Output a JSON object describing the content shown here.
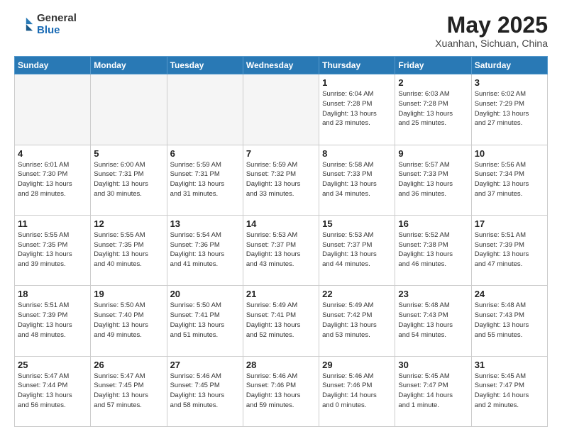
{
  "header": {
    "logo_general": "General",
    "logo_blue": "Blue",
    "month_title": "May 2025",
    "location": "Xuanhan, Sichuan, China"
  },
  "weekdays": [
    "Sunday",
    "Monday",
    "Tuesday",
    "Wednesday",
    "Thursday",
    "Friday",
    "Saturday"
  ],
  "weeks": [
    [
      {
        "day": "",
        "info": ""
      },
      {
        "day": "",
        "info": ""
      },
      {
        "day": "",
        "info": ""
      },
      {
        "day": "",
        "info": ""
      },
      {
        "day": "1",
        "info": "Sunrise: 6:04 AM\nSunset: 7:28 PM\nDaylight: 13 hours\nand 23 minutes."
      },
      {
        "day": "2",
        "info": "Sunrise: 6:03 AM\nSunset: 7:28 PM\nDaylight: 13 hours\nand 25 minutes."
      },
      {
        "day": "3",
        "info": "Sunrise: 6:02 AM\nSunset: 7:29 PM\nDaylight: 13 hours\nand 27 minutes."
      }
    ],
    [
      {
        "day": "4",
        "info": "Sunrise: 6:01 AM\nSunset: 7:30 PM\nDaylight: 13 hours\nand 28 minutes."
      },
      {
        "day": "5",
        "info": "Sunrise: 6:00 AM\nSunset: 7:31 PM\nDaylight: 13 hours\nand 30 minutes."
      },
      {
        "day": "6",
        "info": "Sunrise: 5:59 AM\nSunset: 7:31 PM\nDaylight: 13 hours\nand 31 minutes."
      },
      {
        "day": "7",
        "info": "Sunrise: 5:59 AM\nSunset: 7:32 PM\nDaylight: 13 hours\nand 33 minutes."
      },
      {
        "day": "8",
        "info": "Sunrise: 5:58 AM\nSunset: 7:33 PM\nDaylight: 13 hours\nand 34 minutes."
      },
      {
        "day": "9",
        "info": "Sunrise: 5:57 AM\nSunset: 7:33 PM\nDaylight: 13 hours\nand 36 minutes."
      },
      {
        "day": "10",
        "info": "Sunrise: 5:56 AM\nSunset: 7:34 PM\nDaylight: 13 hours\nand 37 minutes."
      }
    ],
    [
      {
        "day": "11",
        "info": "Sunrise: 5:55 AM\nSunset: 7:35 PM\nDaylight: 13 hours\nand 39 minutes."
      },
      {
        "day": "12",
        "info": "Sunrise: 5:55 AM\nSunset: 7:35 PM\nDaylight: 13 hours\nand 40 minutes."
      },
      {
        "day": "13",
        "info": "Sunrise: 5:54 AM\nSunset: 7:36 PM\nDaylight: 13 hours\nand 41 minutes."
      },
      {
        "day": "14",
        "info": "Sunrise: 5:53 AM\nSunset: 7:37 PM\nDaylight: 13 hours\nand 43 minutes."
      },
      {
        "day": "15",
        "info": "Sunrise: 5:53 AM\nSunset: 7:37 PM\nDaylight: 13 hours\nand 44 minutes."
      },
      {
        "day": "16",
        "info": "Sunrise: 5:52 AM\nSunset: 7:38 PM\nDaylight: 13 hours\nand 46 minutes."
      },
      {
        "day": "17",
        "info": "Sunrise: 5:51 AM\nSunset: 7:39 PM\nDaylight: 13 hours\nand 47 minutes."
      }
    ],
    [
      {
        "day": "18",
        "info": "Sunrise: 5:51 AM\nSunset: 7:39 PM\nDaylight: 13 hours\nand 48 minutes."
      },
      {
        "day": "19",
        "info": "Sunrise: 5:50 AM\nSunset: 7:40 PM\nDaylight: 13 hours\nand 49 minutes."
      },
      {
        "day": "20",
        "info": "Sunrise: 5:50 AM\nSunset: 7:41 PM\nDaylight: 13 hours\nand 51 minutes."
      },
      {
        "day": "21",
        "info": "Sunrise: 5:49 AM\nSunset: 7:41 PM\nDaylight: 13 hours\nand 52 minutes."
      },
      {
        "day": "22",
        "info": "Sunrise: 5:49 AM\nSunset: 7:42 PM\nDaylight: 13 hours\nand 53 minutes."
      },
      {
        "day": "23",
        "info": "Sunrise: 5:48 AM\nSunset: 7:43 PM\nDaylight: 13 hours\nand 54 minutes."
      },
      {
        "day": "24",
        "info": "Sunrise: 5:48 AM\nSunset: 7:43 PM\nDaylight: 13 hours\nand 55 minutes."
      }
    ],
    [
      {
        "day": "25",
        "info": "Sunrise: 5:47 AM\nSunset: 7:44 PM\nDaylight: 13 hours\nand 56 minutes."
      },
      {
        "day": "26",
        "info": "Sunrise: 5:47 AM\nSunset: 7:45 PM\nDaylight: 13 hours\nand 57 minutes."
      },
      {
        "day": "27",
        "info": "Sunrise: 5:46 AM\nSunset: 7:45 PM\nDaylight: 13 hours\nand 58 minutes."
      },
      {
        "day": "28",
        "info": "Sunrise: 5:46 AM\nSunset: 7:46 PM\nDaylight: 13 hours\nand 59 minutes."
      },
      {
        "day": "29",
        "info": "Sunrise: 5:46 AM\nSunset: 7:46 PM\nDaylight: 14 hours\nand 0 minutes."
      },
      {
        "day": "30",
        "info": "Sunrise: 5:45 AM\nSunset: 7:47 PM\nDaylight: 14 hours\nand 1 minute."
      },
      {
        "day": "31",
        "info": "Sunrise: 5:45 AM\nSunset: 7:47 PM\nDaylight: 14 hours\nand 2 minutes."
      }
    ]
  ]
}
